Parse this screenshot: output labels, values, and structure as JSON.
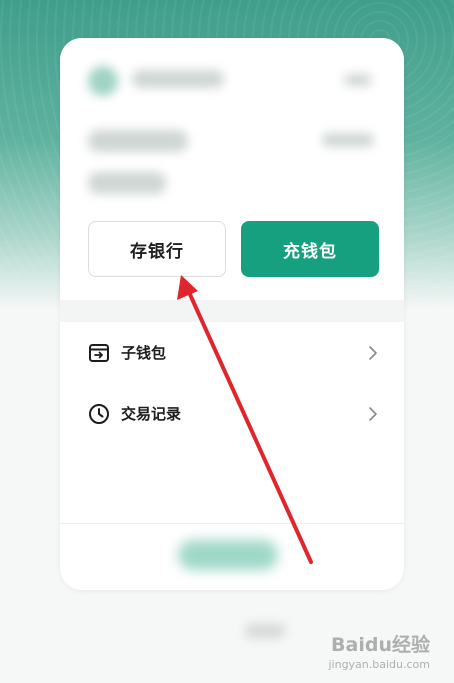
{
  "wallet_card": {
    "actions": {
      "deposit_bank_label": "存银行",
      "top_up_wallet_label": "充钱包"
    },
    "menu": [
      {
        "label": "子钱包",
        "icon": "sub-wallet-icon"
      },
      {
        "label": "交易记录",
        "icon": "clock-icon"
      }
    ]
  },
  "watermark": {
    "brand": "Baidu经验",
    "site": "jingyan.baidu.com"
  },
  "colors": {
    "accent": "#17a07f",
    "arrow": "#e0262d",
    "header_green": "#3f9e8a"
  }
}
